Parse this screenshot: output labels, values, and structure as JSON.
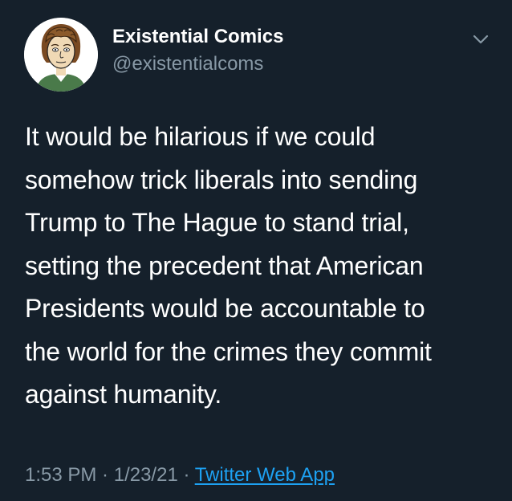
{
  "author": {
    "display_name": "Existential Comics",
    "handle": "@existentialcoms",
    "avatar_icon": "cartoon-portrait-avatar"
  },
  "tweet": {
    "lines": [
      "It would be hilarious if we could",
      "somehow trick liberals into sending",
      "Trump to The Hague to stand trial,",
      "setting the precedent that American",
      "Presidents would be accountable to",
      "the world for the crimes they commit",
      "against humanity."
    ]
  },
  "meta": {
    "time": "1:53 PM",
    "separator": " · ",
    "date": "1/23/21",
    "source": "Twitter Web App"
  },
  "icons": {
    "more": "chevron-down-icon"
  },
  "colors": {
    "background": "#15202b",
    "text": "#ffffff",
    "secondary": "#8899a6",
    "link": "#1da1f2"
  }
}
